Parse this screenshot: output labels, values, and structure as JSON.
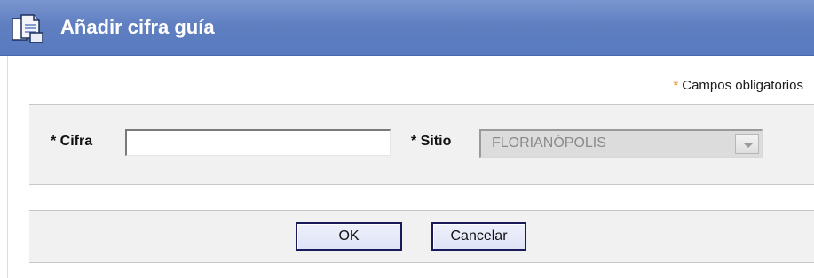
{
  "dialog": {
    "title": "Añadir cifra guía",
    "icon": "documents-icon",
    "required_asterisk": "*",
    "required_note": "Campos obligatorios"
  },
  "form": {
    "cifra": {
      "label": "* Cifra",
      "value": "",
      "placeholder": ""
    },
    "sitio": {
      "label": "* Sitio",
      "selected_value": "FLORIANÓPOLIS",
      "disabled": true
    }
  },
  "buttons": {
    "ok_label": "OK",
    "cancel_label": "Cancelar"
  },
  "colors": {
    "titlebar": "#5f7fc1",
    "panel_bg": "#f1f1f1",
    "asterisk": "#e88a1a",
    "button_border": "#1a1a5a"
  }
}
